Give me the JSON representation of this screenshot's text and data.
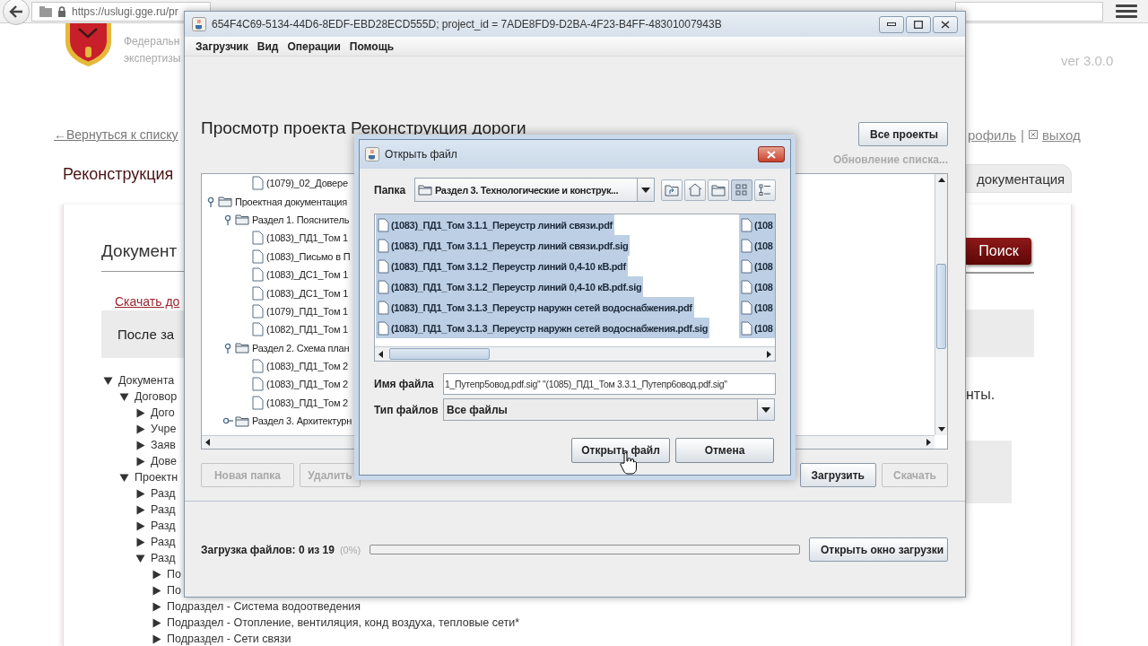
{
  "browser": {
    "url": "https://uslugi.gge.ru/pr",
    "org_name": [
      "Федеральн",
      "экспертизы"
    ],
    "version": "ver 3.0.0",
    "back_link": "←Вернуться к списку",
    "profile_link": "рофиль",
    "separator": "|",
    "logout_link": "выход",
    "project_title": "Реконструкция",
    "tab": {
      "label": "документация",
      "selected": true
    },
    "section_title": "Документ",
    "search_button": "Поиск",
    "download_link": "Скачать до",
    "notice_left": "После за",
    "notice_right": "нты.",
    "doc_tree": [
      {
        "label": "Документа",
        "expanded": true,
        "children": [
          {
            "label": "Договор",
            "expanded": true,
            "children": [
              {
                "label": "Дого",
                "expanded": false
              },
              {
                "label": "Учре",
                "expanded": false
              },
              {
                "label": "Заяв",
                "expanded": false
              },
              {
                "label": "Дове",
                "expanded": false
              }
            ]
          },
          {
            "label": "Проектн",
            "expanded": true,
            "children": [
              {
                "label": "Разд",
                "expanded": false
              },
              {
                "label": "Разд",
                "expanded": false
              },
              {
                "label": "Разд",
                "expanded": false
              },
              {
                "label": "Разд",
                "expanded": false
              },
              {
                "label": "Разд",
                "expanded": true,
                "children": [
                  {
                    "label": "По",
                    "expanded": false
                  },
                  {
                    "label": "По",
                    "expanded": false
                  },
                  {
                    "label": "Подраздел - Система водоотведения",
                    "expanded": false
                  },
                  {
                    "label": "Подраздел - Отопление, вентиляция, конд воздуха, тепловые сети*",
                    "expanded": false
                  },
                  {
                    "label": "Подраздел - Сети связи",
                    "expanded": false
                  }
                ]
              }
            ]
          }
        ]
      }
    ]
  },
  "loader": {
    "title": "654F4C69-5134-44D6-8EDF-EBD28ECD555D; project_id = 7ADE8FD9-D2BA-4F23-B4FF-48301007943B",
    "menu": [
      "Загрузчик",
      "Вид",
      "Операции",
      "Помощь"
    ],
    "heading": "Просмотр проекта Реконструкция дороги",
    "all_projects_button": "Все проекты",
    "refresh_status": "Обновление списка...",
    "tree": [
      {
        "kind": "continuation",
        "children": [
          {
            "kind": "continuation",
            "children": [
              {
                "kind": "file",
                "label": "(1079)_02_Довере"
              }
            ]
          }
        ]
      },
      {
        "kind": "folder",
        "label": "Проектная документация",
        "expanded": true,
        "children": [
          {
            "kind": "folder",
            "label": "Раздел 1. Пояснитель",
            "expanded": true,
            "children": [
              {
                "kind": "file",
                "label": "(1083)_ПД1_Том 1"
              },
              {
                "kind": "file",
                "label": "(1083)_Письмо в П"
              },
              {
                "kind": "file",
                "label": "(1083)_ДС1_Том 1"
              },
              {
                "kind": "file",
                "label": "(1083)_ДС1_Том 1"
              },
              {
                "kind": "file",
                "label": "(1079)_ПД1_Том 1"
              },
              {
                "kind": "file",
                "label": "(1082)_ПД1_Том 1"
              }
            ]
          },
          {
            "kind": "folder",
            "label": "Раздел 2. Схема план",
            "expanded": true,
            "children": [
              {
                "kind": "file",
                "label": "(1083)_ПД1_Том 2"
              },
              {
                "kind": "file",
                "label": "(1083)_ПД1_Том 2"
              },
              {
                "kind": "file",
                "label": "(1083)_ПД1_Том 2"
              }
            ]
          },
          {
            "kind": "folder",
            "label": "Раздел 3. Архитектурн",
            "expanded": false
          }
        ]
      }
    ],
    "left_buttons": [
      {
        "label": "Новая папка",
        "disabled": true
      },
      {
        "label": "Удалить",
        "disabled": true
      }
    ],
    "right_buttons": [
      {
        "label": "Загрузить",
        "disabled": false
      },
      {
        "label": "Скачать",
        "disabled": true
      }
    ],
    "upload_label": "Загрузка файлов: 0 из 19",
    "upload_percent": "(0%)",
    "upload_progress": {
      "level": 0
    },
    "open_upload_window_button": "Открыть окно загрузки"
  },
  "dialog": {
    "title": "Открыть файл",
    "folder_label": "Папка",
    "folder": "Раздел 3. Технологические и конструк...",
    "nav_buttons": [
      {
        "kind": "up"
      },
      {
        "kind": "home"
      },
      {
        "kind": "new_folder"
      }
    ],
    "view_modes": [
      {
        "kind": "list",
        "selected": true
      },
      {
        "kind": "details",
        "selected": false
      }
    ],
    "file_columns": [
      {
        "items": [
          {
            "label": "(1083)_ПД1_Том 3.1.1_Переустр линий связи.pdf",
            "selected": true
          },
          {
            "label": "(1083)_ПД1_Том 3.1.1_Переустр линий связи.pdf.sig",
            "selected": true
          },
          {
            "label": "(1083)_ПД1_Том 3.1.2_Переустр линий 0,4-10 кВ.pdf",
            "selected": true
          },
          {
            "label": "(1083)_ПД1_Том 3.1.2_Переустр линий 0,4-10 кВ.pdf.sig",
            "selected": true
          },
          {
            "label": "(1083)_ПД1_Том 3.1.3_Переустр наружн сетей водоснабжения.pdf",
            "selected": true
          },
          {
            "label": "(1083)_ПД1_Том 3.1.3_Переустр наружн сетей водоснабжения.pdf.sig",
            "selected": true
          }
        ]
      },
      {
        "items": [
          {
            "label": "(108",
            "selected": true
          },
          {
            "label": "(108",
            "selected": true
          },
          {
            "label": "(108",
            "selected": true
          },
          {
            "label": "(108",
            "selected": true
          },
          {
            "label": "(108",
            "selected": true
          },
          {
            "label": "(108",
            "selected": true
          }
        ]
      }
    ],
    "file_name_label": "Имя файла",
    "file_name": "1_Путепр5овод.pdf.sig\" \"(1085)_ПД1_Том 3.3.1_Путепр6овод.pdf.sig\"",
    "file_type_label": "Тип файлов",
    "file_type": "Все файлы",
    "open_button": "Открыть файл",
    "cancel_button": "Отмена"
  }
}
